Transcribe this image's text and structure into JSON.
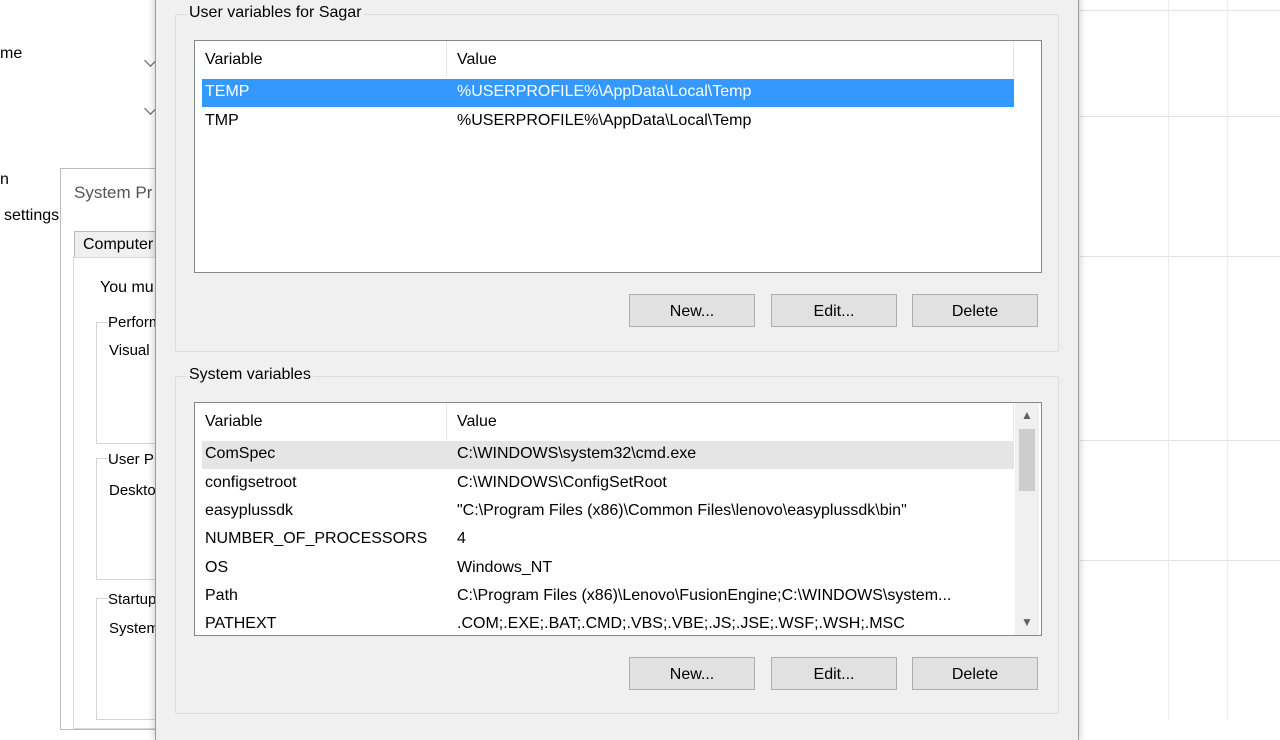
{
  "background": {
    "fragments": {
      "home": "me",
      "n": "n",
      "settings": "settings"
    },
    "system_properties": {
      "title": "System Pr",
      "tab_label": "Computer",
      "line_you_must": "You mu",
      "performance_label": "Perform",
      "visual_label": "Visual",
      "user_profiles_label": "User P",
      "desktop_label": "Deskto",
      "startup_label": "Startup",
      "system_label": "System"
    }
  },
  "dialog": {
    "user_vars": {
      "legend": "User variables for Sagar",
      "columns": [
        "Variable",
        "Value"
      ],
      "rows": [
        {
          "variable": "TEMP",
          "value": "%USERPROFILE%\\AppData\\Local\\Temp",
          "selected": true
        },
        {
          "variable": "TMP",
          "value": "%USERPROFILE%\\AppData\\Local\\Temp",
          "selected": false
        }
      ],
      "buttons": {
        "new": "New...",
        "edit": "Edit...",
        "delete": "Delete"
      }
    },
    "system_vars": {
      "legend": "System variables",
      "columns": [
        "Variable",
        "Value"
      ],
      "rows": [
        {
          "variable": "ComSpec",
          "value": "C:\\WINDOWS\\system32\\cmd.exe"
        },
        {
          "variable": "configsetroot",
          "value": "C:\\WINDOWS\\ConfigSetRoot"
        },
        {
          "variable": "easyplussdk",
          "value": "\"C:\\Program Files (x86)\\Common Files\\lenovo\\easyplussdk\\bin\""
        },
        {
          "variable": "NUMBER_OF_PROCESSORS",
          "value": "4"
        },
        {
          "variable": "OS",
          "value": "Windows_NT"
        },
        {
          "variable": "Path",
          "value": "C:\\Program Files (x86)\\Lenovo\\FusionEngine;C:\\WINDOWS\\system..."
        },
        {
          "variable": "PATHEXT",
          "value": ".COM;.EXE;.BAT;.CMD;.VBS;.VBE;.JS;.JSE;.WSF;.WSH;.MSC"
        }
      ],
      "buttons": {
        "new": "New...",
        "edit": "Edit...",
        "delete": "Delete"
      }
    }
  },
  "colors": {
    "selection": "#3399ff",
    "dialog_bg": "#f0f0f0",
    "button_bg": "#e1e1e1"
  }
}
